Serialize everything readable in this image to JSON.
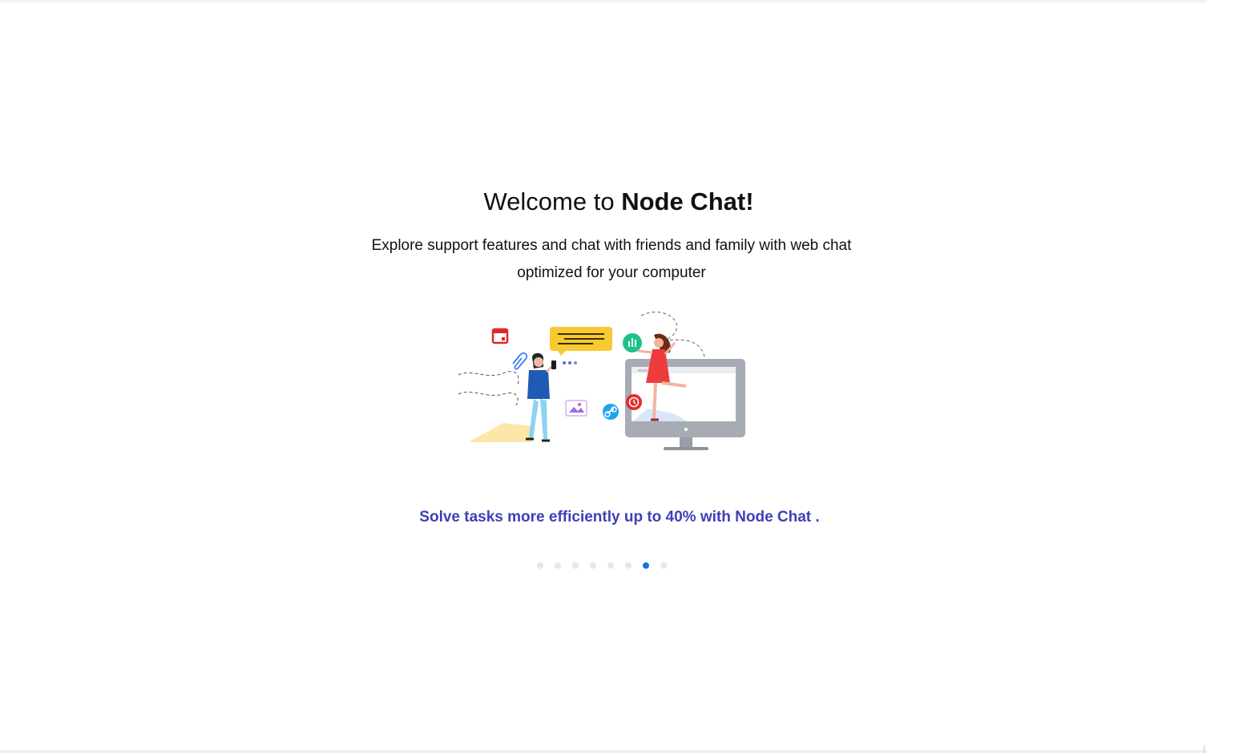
{
  "welcome": {
    "prefix": "Welcome to ",
    "brand": "Node Chat",
    "suffix": "!"
  },
  "subtitle": "Explore support features and chat with friends and family with web chat optimized for your computer",
  "tagline": "Solve tasks more efficiently up to 40% with Node Chat .",
  "carousel": {
    "slides": 8,
    "active_index": 6,
    "active_color": "#1a6fe8",
    "inactive_color": "#e4e7eb"
  },
  "colors": {
    "tagline": "#3f3fb8",
    "text": "#111111"
  },
  "illustration": {
    "icons": [
      "calendar-icon",
      "paperclip-icon",
      "chat-bubble-icon",
      "chart-icon",
      "image-icon",
      "link-icon",
      "alarm-icon",
      "monitor-icon"
    ]
  }
}
